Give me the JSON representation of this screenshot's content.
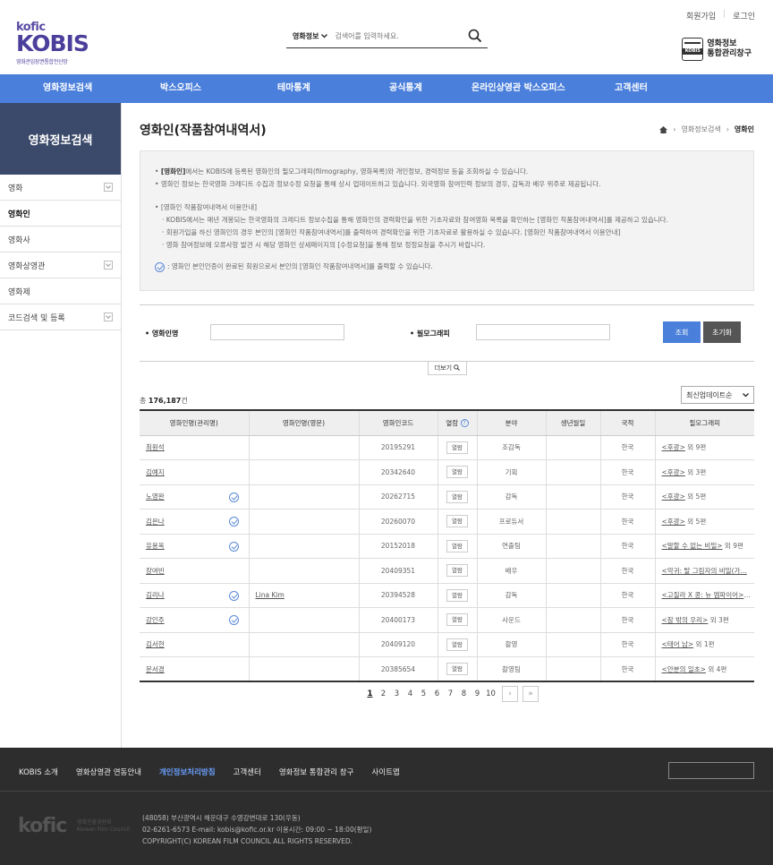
{
  "header": {
    "join": "회원가입",
    "login": "로그인",
    "logo_kofic": "kofic",
    "logo_kobis": "KOBIS",
    "logo_sub": "영화관입장권통합전산망",
    "search_select": "영화정보",
    "search_placeholder": "검색어를 입력하세요.",
    "store_line1": "영화정보",
    "store_line2": "통합관리창구",
    "store_icon_text": "KOBIS"
  },
  "gnb": [
    "영화정보검색",
    "박스오피스",
    "테마통계",
    "공식통계",
    "온라인상영관 박스오피스",
    "고객센터"
  ],
  "sidebar": {
    "title": "영화정보검색",
    "items": [
      {
        "label": "영화",
        "expand": true
      },
      {
        "label": "영화인",
        "expand": false,
        "active": true
      },
      {
        "label": "영화사",
        "expand": false
      },
      {
        "label": "영화상영관",
        "expand": true
      },
      {
        "label": "영화제",
        "expand": false
      },
      {
        "label": "코드검색 및 등록",
        "expand": true
      }
    ]
  },
  "page": {
    "title": "영화인(작품참여내역서)",
    "breadcrumb": [
      "영화정보검색",
      "영화인"
    ]
  },
  "notice": {
    "line1_bold": "[영화인]",
    "line1_rest": "에서는 KOBIS에 등록된 영화인의 필모그래피(filmography, 영화목록)와 개인정보, 경력정보 등을 조회하실 수 있습니다.",
    "line2": "영화인 정보는 한국영화 크레디트 수집과 정보수정 요청을 통해 상시 업데이트하고 있습니다. 외국영화 참여인력 정보의 경우, 감독과 배우 위주로 제공됩니다.",
    "line3": "[영화인 작품참여내역서 이용안내]",
    "line4": "KOBIS에서는 매년 개봉되는 한국영화의 크레디트 정보수집을 통해 영화인의 경력확인을 위한 기초자료와 참여영화 목록을 확인하는 [영화인 작품참여내역서]를 제공하고 있습니다.",
    "line5": "회원가입을 하신 영화인의 경우 본인의 [영화인 작품참여내역서]를 출력하여 경력확인을 위한 기초자료로 활용하실 수 있습니다. [영화인 작품참여내역서 이용안내]",
    "line6": "영화 참여정보에 오류사항 발견 시 해당 영화인 상세페이지의 [수정요청]을 통해 정보 정정요청을 주시기 바랍니다.",
    "line7": ": 영화인 본인인증이 완료된 회원으로서 본인의 [영화인 작품참여내역서]를 출력할 수 있습니다."
  },
  "form": {
    "name_label": "영화인명",
    "filmo_label": "필모그래피",
    "search_btn": "조회",
    "reset_btn": "초기화",
    "more_btn": "더보기"
  },
  "list": {
    "total_prefix": "총",
    "total_count": "176,187",
    "total_suffix": "건",
    "sort": "최신업데이트순",
    "columns": [
      "영화인명(관리명)",
      "영화인명(영문)",
      "영화인코드",
      "열람",
      "분야",
      "생년월일",
      "국적",
      "필모그래피"
    ],
    "view_label": "열람",
    "rows": [
      {
        "name": "최원석",
        "cert": false,
        "en": "",
        "code": "20195291",
        "view": "열람",
        "part": "조감독",
        "birth": "",
        "nation": "한국",
        "filmo_link": "<후광>",
        "filmo_rest": " 외 9편"
      },
      {
        "name": "김예지",
        "cert": false,
        "en": "",
        "code": "20342640",
        "view": "열람",
        "part": "기획",
        "birth": "",
        "nation": "한국",
        "filmo_link": "<후광>",
        "filmo_rest": " 외 3편"
      },
      {
        "name": "노영완",
        "cert": true,
        "en": "",
        "code": "20262715",
        "view": "열람",
        "part": "감독",
        "birth": "",
        "nation": "한국",
        "filmo_link": "<후광>",
        "filmo_rest": " 외 5편"
      },
      {
        "name": "김은나",
        "cert": true,
        "en": "",
        "code": "20260070",
        "view": "열람",
        "part": "프로듀서",
        "birth": "",
        "nation": "한국",
        "filmo_link": "<후광>",
        "filmo_rest": " 외 5편"
      },
      {
        "name": "유용옥",
        "cert": true,
        "en": "",
        "code": "20152018",
        "view": "열람",
        "part": "연출팀",
        "birth": "",
        "nation": "한국",
        "filmo_link": "<말할 수 없는 비밀>",
        "filmo_rest": " 외 9편"
      },
      {
        "name": "장여빈",
        "cert": false,
        "en": "",
        "code": "20409351",
        "view": "열람",
        "part": "배우",
        "birth": "",
        "nation": "한국",
        "filmo_link": "<악귀: 탈 그림자의 비밀(가…",
        "filmo_rest": ""
      },
      {
        "name": "김리나",
        "cert": true,
        "en": "Lina Kim",
        "code": "20394528",
        "view": "열람",
        "part": "감독",
        "birth": "",
        "nation": "한국",
        "filmo_link": "<고질라 X 콩: 뉴 엠파이어>",
        "filmo_rest": " …"
      },
      {
        "name": "강인주",
        "cert": true,
        "en": "",
        "code": "20400173",
        "view": "열람",
        "part": "사운드",
        "birth": "",
        "nation": "한국",
        "filmo_link": "<잠 밖의 우리>",
        "filmo_rest": " 외 3편"
      },
      {
        "name": "김서현",
        "cert": false,
        "en": "",
        "code": "20409120",
        "view": "열람",
        "part": "촬영",
        "birth": "",
        "nation": "한국",
        "filmo_link": "<태어 남>",
        "filmo_rest": " 외 1편"
      },
      {
        "name": "문서경",
        "cert": false,
        "en": "",
        "code": "20385654",
        "view": "열람",
        "part": "촬영팀",
        "birth": "",
        "nation": "한국",
        "filmo_link": "<안분의 일초>",
        "filmo_rest": " 외 4편"
      }
    ]
  },
  "pagination": {
    "pages": [
      "1",
      "2",
      "3",
      "4",
      "5",
      "6",
      "7",
      "8",
      "9",
      "10"
    ],
    "current": "1",
    "next": "›",
    "last": "»"
  },
  "footer": {
    "nav": [
      "KOBIS 소개",
      "영화상영관 연동안내",
      "개인정보처리방침",
      "고객센터",
      "영화정보 통합관리 창구",
      "사이트맵"
    ],
    "highlight_index": 2,
    "logo": "kofic",
    "logo_sub1": "영화진흥위원회",
    "logo_sub2": "Korean Film Council",
    "address": "(48058) 부산광역시 해운대구 수영강변대로 130(우동)",
    "contact": "02-6261-6573     E-mail: kobis@kofic.or.kr     이용시간: 09:00 ~ 18:00(평일)",
    "copyright": "COPYRIGHT(C) KOREAN FILM COUNCIL ALL RIGHTS RESERVED."
  }
}
